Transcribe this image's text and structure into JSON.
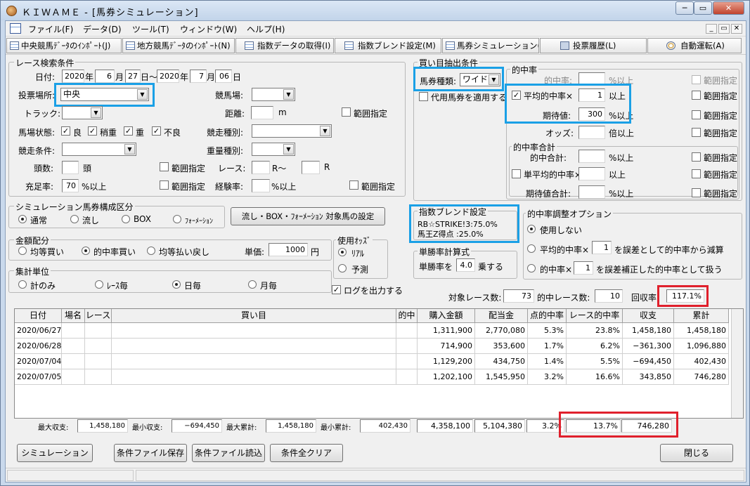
{
  "window": {
    "title": "ＫＩＷＡＭＥ - [馬券シミュレーション]",
    "min": "─",
    "max": "▭",
    "close": "✕"
  },
  "menu": {
    "items": [
      "ファイル(F)",
      "データ(D)",
      "ツール(T)",
      "ウィンドウ(W)",
      "ヘルプ(H)"
    ],
    "mdi": [
      "_",
      "▭",
      "✕"
    ]
  },
  "toolbar": {
    "items": [
      "中央競馬ﾃﾞｰﾀのｲﾝﾎﾟｰﾄ(J)",
      "地方競馬ﾃﾞｰﾀのｲﾝﾎﾟｰﾄ(N)",
      "指数データの取得(I)",
      "指数ブレンド設定(M)",
      "馬券シミュレーション(B)",
      "投票履歴(L)",
      "自動運転(A)"
    ]
  },
  "race": {
    "title": "レース検索条件",
    "date_label": "日付:",
    "from_y": "2020",
    "from_m": "6",
    "from_d": "27",
    "to_y": "2020",
    "to_m": "7",
    "to_d": "06",
    "u_year": "年",
    "u_month": "月",
    "u_day": "日",
    "sep": "日〜",
    "vote_label": "投票場所:",
    "vote_value": "中央",
    "track_label": "競馬場:",
    "trk_label": "トラック:",
    "dist_label": "距離:",
    "dist_unit": "m",
    "range": "範囲指定",
    "cond_label": "馬場状態:",
    "cond_items": [
      "良",
      "稍重",
      "重",
      "不良"
    ],
    "kind_label": "競走種別:",
    "rcond_label": "競走条件:",
    "wt_label": "重量種別:",
    "heads_label": "頭数:",
    "heads_unit": "頭",
    "race_label": "レース:",
    "race_from": "R〜",
    "race_to": "R",
    "fill_label": "充足率:",
    "fill_value": "70",
    "fill_unit": "%以上",
    "exp_label": "経験率:",
    "exp_unit": "%以上"
  },
  "sim": {
    "title": "シミュレーション馬券構成区分",
    "opts": [
      "通常",
      "流し",
      "BOX",
      "ﾌｫｰﾒｰｼｮﾝ"
    ],
    "setbtn": "流し・BOX・ﾌｫｰﾒｰｼｮﾝ 対象馬の設定"
  },
  "money": {
    "title": "金額配分",
    "opts": [
      "均等買い",
      "的中率買い",
      "均等払い戻し"
    ],
    "unit_label": "単価:",
    "unit_value": "1000",
    "yen": "円"
  },
  "odds": {
    "title": "使用ｵｯｽﾞ",
    "opts": [
      "ﾘｱﾙ",
      "予測"
    ]
  },
  "agg": {
    "title": "集計単位",
    "opts": [
      "計のみ",
      "ﾚｰｽ毎",
      "日毎",
      "月毎"
    ],
    "log": "ログを出力する"
  },
  "buy": {
    "title": "買い目抽出条件",
    "type_label": "馬券種類:",
    "type_value": "ワイド",
    "proxy": "代用馬券を適用する"
  },
  "hit": {
    "title": "的中率",
    "rate_label": "的中率:",
    "rate_unit": "%以上",
    "avg_label": "平均的中率×",
    "avg_value": "1",
    "avg_unit": "以上",
    "exp_label": "期待値:",
    "exp_value": "300",
    "exp_unit": "%以上",
    "odds_label": "オッズ:",
    "odds_unit": "倍以上",
    "range": "範囲指定"
  },
  "hitsum": {
    "title": "的中率合計",
    "sum_label": "的中合計:",
    "sum_unit": "%以上",
    "single_label": "単平均的中率×",
    "single_unit": "以上",
    "expsum_label": "期待値合計:",
    "expsum_unit": "%以上"
  },
  "blend": {
    "title": "指数ブレンド設定",
    "line1": "RB☆STRIKE!3:75.0%",
    "line2": "馬王Z得点 :25.0%"
  },
  "win_calc": {
    "title": "単勝率計算式",
    "label": "単勝率を",
    "value": "4.0",
    "unit": "乗する"
  },
  "adjust": {
    "title": "的中率調整オプション",
    "opt1": "使用しない",
    "opt2a": "平均的中率×",
    "opt2v": "1",
    "opt2b": "を誤差として的中率から減算",
    "opt3a": "的中率×",
    "opt3v": "1",
    "opt3b": "を誤差補正した的中率として扱う"
  },
  "summary": {
    "races_label": "対象レース数:",
    "races": "73",
    "hitraces_label": "的中レース数:",
    "hitraces": "10",
    "return_label": "回収率:",
    "return": "117.1%"
  },
  "table": {
    "headers": [
      "日付",
      "場名",
      "レース",
      "買い目",
      "的中",
      "購入金額",
      "配当金",
      "点的中率",
      "レース的中率",
      "収支",
      "累計"
    ],
    "rows": [
      [
        "2020/06/27",
        "",
        "",
        "",
        "",
        "1,311,900",
        "2,770,080",
        "5.3%",
        "23.8%",
        "1,458,180",
        "1,458,180"
      ],
      [
        "2020/06/28",
        "",
        "",
        "",
        "",
        "714,900",
        "353,600",
        "1.7%",
        "6.2%",
        "−361,300",
        "1,096,880"
      ],
      [
        "2020/07/04",
        "",
        "",
        "",
        "",
        "1,129,200",
        "434,750",
        "1.4%",
        "5.5%",
        "−694,450",
        "402,430"
      ],
      [
        "2020/07/05",
        "",
        "",
        "",
        "",
        "1,202,100",
        "1,545,950",
        "3.2%",
        "16.6%",
        "343,850",
        "746,280"
      ]
    ]
  },
  "totals": {
    "maxp_label": "最大収支:",
    "maxp": "1,458,180",
    "minp_label": "最小収支:",
    "minp": "−694,450",
    "maxc_label": "最大累計:",
    "maxc": "1,458,180",
    "minc_label": "最小累計:",
    "minc": "402,430",
    "buy": "4,358,100",
    "pay": "5,104,380",
    "pt": "3.2%",
    "race": "13.7%",
    "cum": "746,280"
  },
  "buttons": {
    "simulate": "シミュレーション",
    "save": "条件ファイル保存",
    "load": "条件ファイル読込",
    "clear": "条件全クリア",
    "close": "閉じる"
  }
}
